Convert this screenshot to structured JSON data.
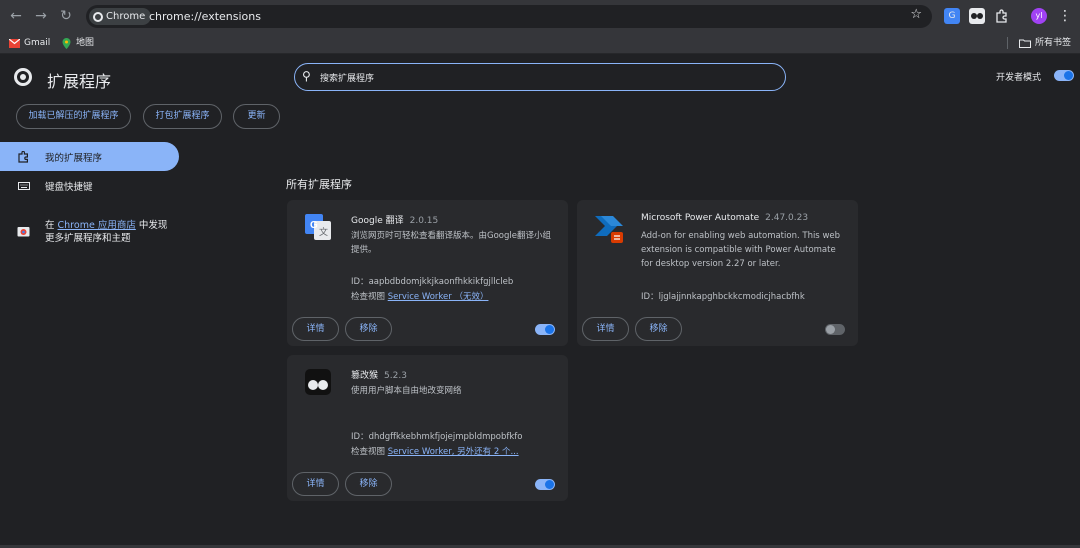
{
  "browser": {
    "omnibox_chip": "Chrome",
    "url": "chrome://extensions",
    "profile_initial": "yl",
    "bookmarks": [
      "Gmail",
      "地图"
    ],
    "all_bookmarks": "所有书签"
  },
  "header": {
    "title": "扩展程序",
    "search_placeholder": "搜索扩展程序",
    "dev_mode_label": "开发者模式",
    "dev_mode_on": true
  },
  "actions": [
    "加载已解压的扩展程序",
    "打包扩展程序",
    "更新"
  ],
  "sidebar": {
    "items": [
      {
        "label": "我的扩展程序",
        "active": true
      },
      {
        "label": "键盘快捷键",
        "active": false
      }
    ],
    "store_prefix": "在 ",
    "store_link": "Chrome 应用商店",
    "store_suffix": " 中发现更多扩展程序和主题"
  },
  "section_title": "所有扩展程序",
  "extensions": [
    {
      "name": "Google 翻译",
      "version": "2.0.15",
      "description": "浏览网页时可轻松查看翻译版本。由Google翻译小组提供。",
      "id_label": "ID：",
      "id": "aapbdbdomjkkjkaonfhkkikfgjllcleb",
      "inspect_label": "检查视图 ",
      "inspect_link": "Service Worker （无效）",
      "details": "详情",
      "remove": "移除",
      "enabled": true
    },
    {
      "name": "Microsoft Power Automate",
      "version": "2.47.0.23",
      "description": "Add-on for enabling web automation. This web extension is compatible with Power Automate for desktop version 2.27 or later.",
      "id_label": "ID：",
      "id": "ljglajjnnkapghbckkcmodicjhacbfhk",
      "details": "详情",
      "remove": "移除",
      "enabled": false
    },
    {
      "name": "篡改猴",
      "version": "5.2.3",
      "description": "使用用户脚本自由地改变网络",
      "id_label": "ID：",
      "id": "dhdgffkkebhmkfjojejmpbldmpobfkfo",
      "inspect_label": "检查视图 ",
      "inspect_link": "Service Worker, 另外还有 2 个...",
      "details": "详情",
      "remove": "移除",
      "enabled": true
    }
  ]
}
